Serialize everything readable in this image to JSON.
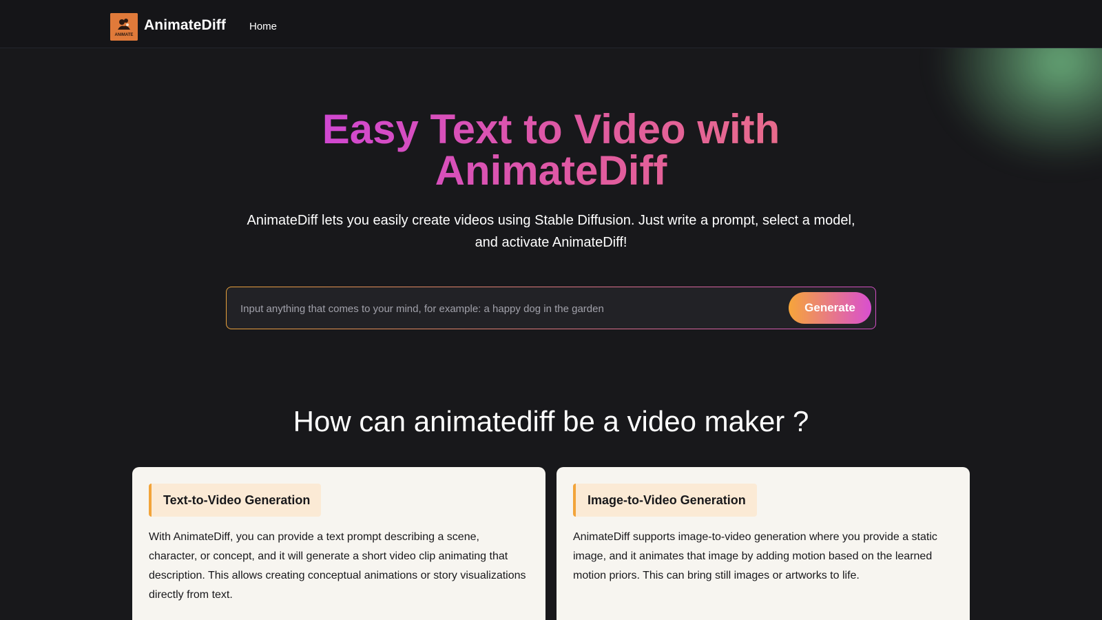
{
  "navbar": {
    "brand": "AnimateDiff",
    "logo_text": "ANIMATE",
    "home_label": "Home"
  },
  "hero": {
    "title": "Easy Text to Video with AnimateDiff",
    "subtitle": "AnimateDiff lets you easily create videos using Stable Diffusion. Just write a prompt, select a model, and activate AnimateDiff!"
  },
  "prompt": {
    "value": "",
    "placeholder": "Input anything that comes to your mind, for example: a happy dog in the garden",
    "button_label": "Generate"
  },
  "section": {
    "title": "How can animatediff be a video maker ?"
  },
  "cards": [
    {
      "title": "Text-to-Video Generation",
      "text": "With AnimateDiff, you can provide a text prompt describing a scene, character, or concept, and it will generate a short video clip animating that description. This allows creating conceptual animations or story visualizations directly from text."
    },
    {
      "title": "Image-to-Video Generation",
      "text": "AnimateDiff supports image-to-video generation where you provide a static image, and it animates that image by adding motion based on the learned motion priors. This can bring still images or artworks to life."
    }
  ],
  "colors": {
    "background": "#18181b",
    "accent_orange": "#f6a53a",
    "accent_magenta": "#d94fd0",
    "card_background": "#f7f5f0",
    "glow_green": "#78c88c"
  },
  "icons": {
    "logo": "animate-logo-icon"
  }
}
